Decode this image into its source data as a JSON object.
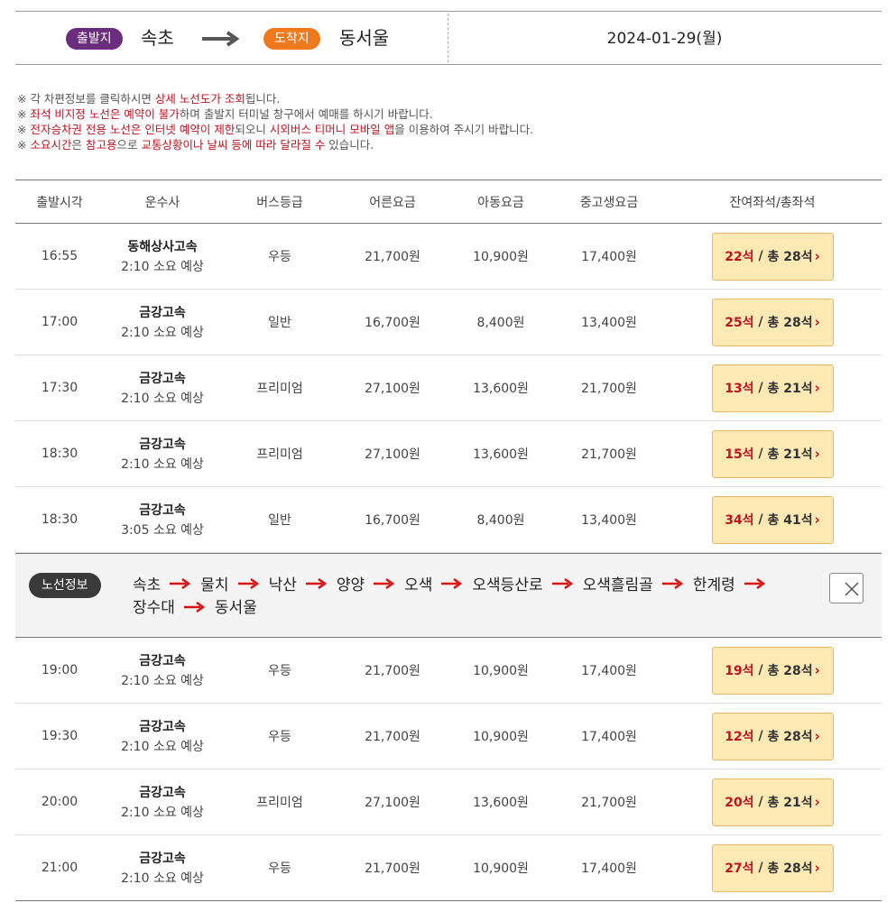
{
  "route": {
    "dep_label": "출발지",
    "dep_city": "속초",
    "arr_label": "도착지",
    "arr_city": "동서울",
    "date": "2024-01-29(월)"
  },
  "notices": [
    [
      {
        "t": "※ 각 차편정보를 클릭하시면 "
      },
      {
        "t": "상세 노선도가 조회",
        "h": true
      },
      {
        "t": "됩니다."
      }
    ],
    [
      {
        "t": "※ "
      },
      {
        "t": "좌석 비지정 노선은 예약이 불가",
        "h": true
      },
      {
        "t": "하며 출발지 터미널 창구에서 예매를 하시기 바랍니다."
      }
    ],
    [
      {
        "t": "※ "
      },
      {
        "t": "전자승차권 전용 노선은 인터넷 예약이 제한",
        "h": true
      },
      {
        "t": "되오니 "
      },
      {
        "t": "시외버스 티머니 모바일 앱",
        "h": true
      },
      {
        "t": "을 이용하여 주시기 바랍니다."
      }
    ],
    [
      {
        "t": "※ "
      },
      {
        "t": "소요시간",
        "h": true
      },
      {
        "t": "은 "
      },
      {
        "t": "참고용",
        "h": true
      },
      {
        "t": "으로 "
      },
      {
        "t": "교통상황이나 날씨 등에 따라 달라질 수",
        "h": true
      },
      {
        "t": " 있습니다."
      }
    ]
  ],
  "table": {
    "headers": [
      "출발시각",
      "운수사",
      "버스등급",
      "어른요금",
      "아동요금",
      "중고생요금",
      "잔여좌석/총좌석"
    ],
    "seat_total_prefix": "총",
    "rows_before": [
      {
        "time": "16:55",
        "operator": "동해상사고속",
        "duration": "2:10 소요 예상",
        "grade": "우등",
        "adult": "21,700원",
        "child": "10,900원",
        "youth": "17,400원",
        "remain": "22석",
        "total": "28석"
      },
      {
        "time": "17:00",
        "operator": "금강고속",
        "duration": "2:10 소요 예상",
        "grade": "일반",
        "adult": "16,700원",
        "child": "8,400원",
        "youth": "13,400원",
        "remain": "25석",
        "total": "28석"
      },
      {
        "time": "17:30",
        "operator": "금강고속",
        "duration": "2:10 소요 예상",
        "grade": "프리미엄",
        "adult": "27,100원",
        "child": "13,600원",
        "youth": "21,700원",
        "remain": "13석",
        "total": "21석"
      },
      {
        "time": "18:30",
        "operator": "금강고속",
        "duration": "2:10 소요 예상",
        "grade": "프리미엄",
        "adult": "27,100원",
        "child": "13,600원",
        "youth": "21,700원",
        "remain": "15석",
        "total": "21석"
      },
      {
        "time": "18:30",
        "operator": "금강고속",
        "duration": "3:05 소요 예상",
        "grade": "일반",
        "adult": "16,700원",
        "child": "8,400원",
        "youth": "13,400원",
        "remain": "34석",
        "total": "41석"
      }
    ],
    "rows_after": [
      {
        "time": "19:00",
        "operator": "금강고속",
        "duration": "2:10 소요 예상",
        "grade": "우등",
        "adult": "21,700원",
        "child": "10,900원",
        "youth": "17,400원",
        "remain": "19석",
        "total": "28석"
      },
      {
        "time": "19:30",
        "operator": "금강고속",
        "duration": "2:10 소요 예상",
        "grade": "우등",
        "adult": "21,700원",
        "child": "10,900원",
        "youth": "17,400원",
        "remain": "12석",
        "total": "28석"
      },
      {
        "time": "20:00",
        "operator": "금강고속",
        "duration": "2:10 소요 예상",
        "grade": "프리미엄",
        "adult": "27,100원",
        "child": "13,600원",
        "youth": "21,700원",
        "remain": "20석",
        "total": "21석"
      },
      {
        "time": "21:00",
        "operator": "금강고속",
        "duration": "2:10 소요 예상",
        "grade": "우등",
        "adult": "21,700원",
        "child": "10,900원",
        "youth": "17,400원",
        "remain": "27석",
        "total": "28석"
      }
    ]
  },
  "route_info": {
    "label": "노선정보",
    "stops": [
      "속초",
      "물치",
      "낙산",
      "양양",
      "오색",
      "오색등산로",
      "오색흘림골",
      "한계령",
      "장수대",
      "동서울"
    ],
    "arrow_icon": "red-arrow-icon",
    "close_icon": "close-icon"
  }
}
